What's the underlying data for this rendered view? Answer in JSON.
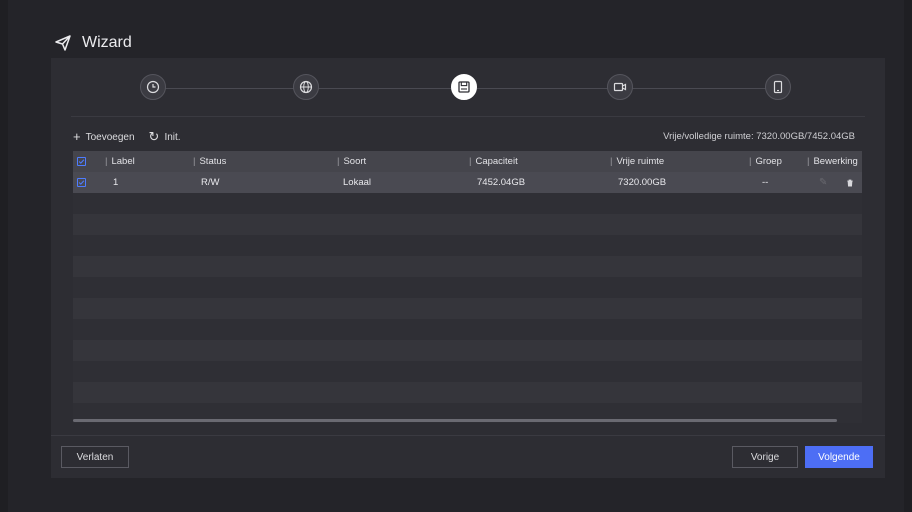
{
  "header": {
    "title": "Wizard",
    "icon": "paper-plane-icon"
  },
  "steps": [
    {
      "icon": "clock-icon",
      "active": false
    },
    {
      "icon": "globe-icon",
      "active": false
    },
    {
      "icon": "storage-icon",
      "active": true
    },
    {
      "icon": "camera-icon",
      "active": false
    },
    {
      "icon": "phone-icon",
      "active": false
    }
  ],
  "toolbar": {
    "add_label": "Toevoegen",
    "init_label": "Init."
  },
  "free_space": "Vrije/volledige ruimte: 7320.00GB/7452.04GB",
  "table": {
    "columns": [
      "Label",
      "Status",
      "Soort",
      "Capaciteit",
      "Vrije ruimte",
      "Groep",
      "Bewerking"
    ],
    "rows": [
      {
        "label": "1",
        "status": "R/W",
        "soort": "Lokaal",
        "capaciteit": "7452.04GB",
        "vrije_ruimte": "7320.00GB",
        "groep": "--"
      }
    ]
  },
  "buttons": {
    "exit": "Verlaten",
    "prev": "Vorige",
    "next": "Volgende"
  },
  "colors": {
    "accent": "#4d6ef5",
    "background": "#2d2d33"
  }
}
